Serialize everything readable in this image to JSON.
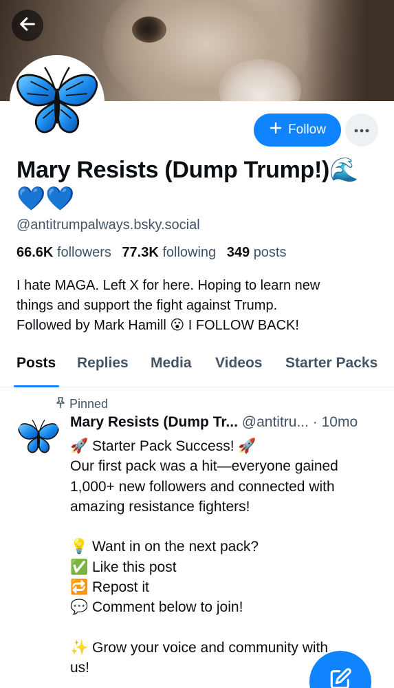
{
  "header": {
    "back_icon": "arrow-left-icon",
    "banner": "goat-closeup-photo",
    "avatar": "blue-butterfly"
  },
  "actions": {
    "follow_label": "Follow",
    "follow_icon": "plus-icon",
    "more_icon": "ellipsis-icon"
  },
  "profile": {
    "display_name": "Mary Resists (Dump Trump!)🌊💙💙",
    "handle": "@antitrumpalways.bsky.social",
    "followers_count": "66.6K",
    "followers_label": "followers",
    "following_count": "77.3K",
    "following_label": "following",
    "posts_count": "349",
    "posts_label": "posts",
    "bio_lines": [
      "I hate MAGA. Left X for here. Hoping to learn new",
      "things and support the fight against Trump.",
      "Followed by Mark Hamill 😮 I FOLLOW BACK!"
    ]
  },
  "tabs": [
    {
      "label": "Posts",
      "active": true
    },
    {
      "label": "Replies",
      "active": false
    },
    {
      "label": "Media",
      "active": false
    },
    {
      "label": "Videos",
      "active": false
    },
    {
      "label": "Starter Packs",
      "active": false
    }
  ],
  "post": {
    "pinned_label": "Pinned",
    "author_name": "Mary Resists (Dump Tr...",
    "author_handle": "@antitru...",
    "time": "· 10mo",
    "lines": [
      "🚀 Starter Pack Success! 🚀",
      "Our first pack was a hit—everyone gained",
      "1,000+ new followers and connected with",
      "amazing resistance fighters!",
      "",
      "💡 Want in on the next pack?",
      "✅ Like this post",
      "🔁 Repost it",
      "💬 Comment below to join!",
      "",
      "✨ Grow your voice and community with",
      "us!"
    ]
  },
  "fab": {
    "icon": "compose-icon"
  },
  "colors": {
    "accent": "#1083fe",
    "muted_text": "#425466",
    "primary_text": "#0b0f14"
  }
}
